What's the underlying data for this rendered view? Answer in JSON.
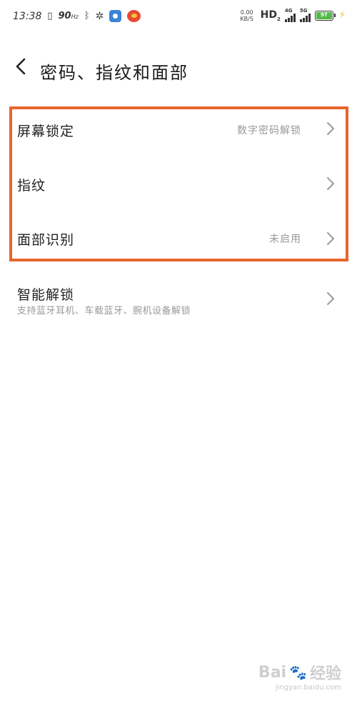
{
  "status_bar": {
    "time": "13:38",
    "refresh_rate": "90",
    "refresh_unit": "Hz",
    "net_speed_value": "0.00",
    "net_speed_unit": "KB/S",
    "hd_label": "HD",
    "hd_sub": "2",
    "sim1_gen": "4G",
    "sim2_gen": "5G",
    "battery_level": "97",
    "battery_color": "#56b84a"
  },
  "header": {
    "title": "密码、指纹和面部"
  },
  "settings": {
    "screen_lock": {
      "label": "屏幕锁定",
      "value": "数字密码解锁"
    },
    "fingerprint": {
      "label": "指纹"
    },
    "face_recognition": {
      "label": "面部识别",
      "value": "未启用"
    },
    "smart_unlock": {
      "label": "智能解锁",
      "description": "支持蓝牙耳机、车载蓝牙、腕机设备解锁"
    }
  },
  "highlight_color": "#e8652c",
  "watermark": {
    "logo_text": "Bai",
    "logo_suffix": "经验",
    "url": "jingyan.baidu.com"
  },
  "icons": {
    "back": "chevron-left-icon",
    "row_arrow": "chevron-right-icon"
  }
}
